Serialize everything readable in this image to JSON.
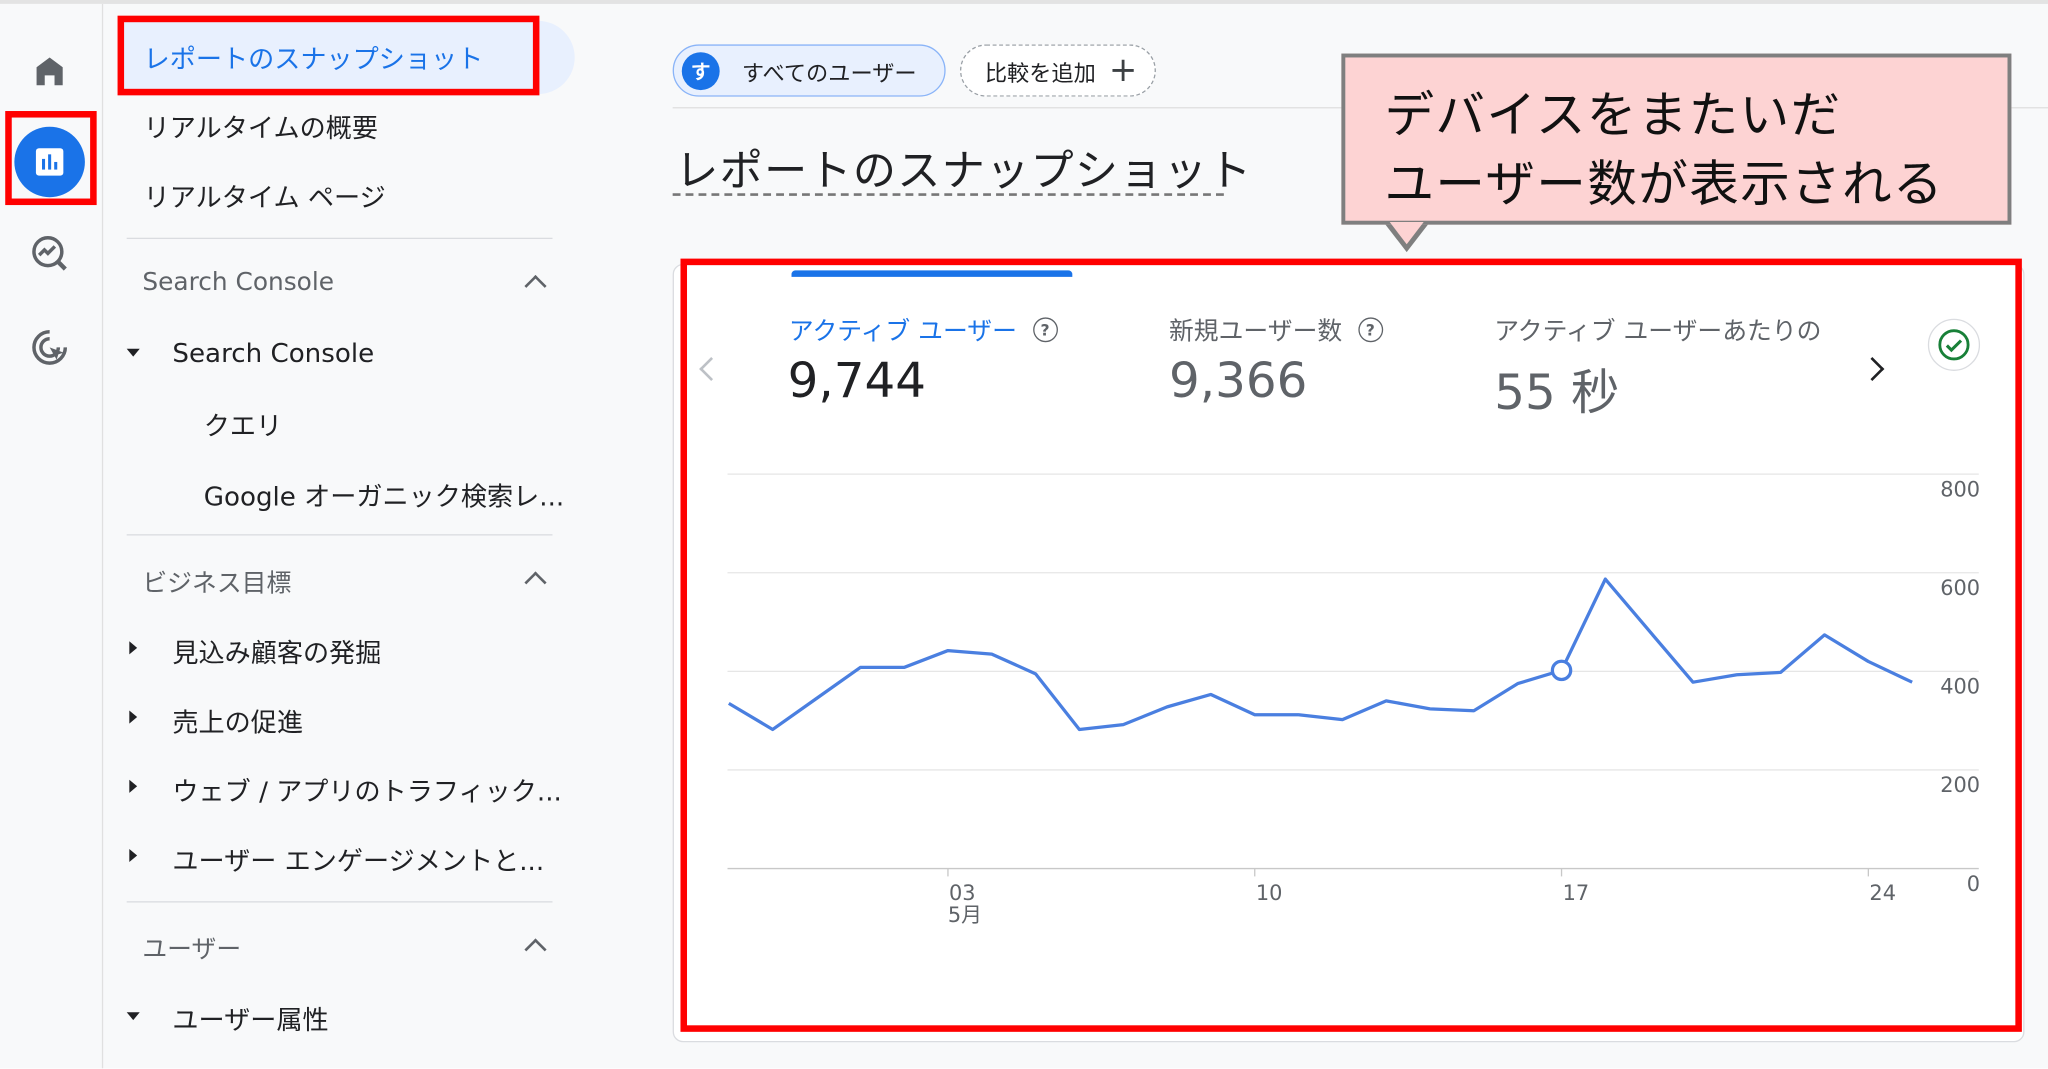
{
  "colors": {
    "accent": "#1a73e8",
    "highlight_box": "#ff0000",
    "callout_bg": "#fdd3d3",
    "callout_border": "#7f7f7f",
    "line": "#4a7fe0"
  },
  "rail": {
    "icons": [
      "home-icon",
      "reports-icon",
      "explore-icon",
      "advertising-icon"
    ]
  },
  "nav": {
    "active_item": "レポートのスナップショット",
    "items": [
      "リアルタイムの概要",
      "リアルタイム ページ"
    ],
    "sections": [
      {
        "title": "Search Console",
        "items": [
          {
            "label": "Search Console",
            "expanded": true
          },
          {
            "label": "クエリ"
          },
          {
            "label": "Google オーガニック検索レ..."
          }
        ]
      },
      {
        "title": "ビジネス目標",
        "items": [
          {
            "label": "見込み顧客の発掘"
          },
          {
            "label": "売上の促進"
          },
          {
            "label": "ウェブ / アプリのトラフィック..."
          },
          {
            "label": "ユーザー エンゲージメントと..."
          }
        ]
      },
      {
        "title": "ユーザー",
        "items": [
          {
            "label": "ユーザー属性",
            "expanded": true
          }
        ]
      }
    ]
  },
  "header": {
    "segment_avatar": "す",
    "segment_label": "すべてのユーザー",
    "compare_label": "比較を追加",
    "page_title": "レポートのスナップショット"
  },
  "callout": {
    "line1": "デバイスをまたいだ",
    "line2": "ユーザー数が表示される"
  },
  "metrics": [
    {
      "label": "アクティブ ユーザー",
      "value": "9,744",
      "active": true
    },
    {
      "label": "新規ユーザー数",
      "value": "9,366"
    },
    {
      "label": "アクティブ ユーザーあたりの",
      "value": "55 秒"
    }
  ],
  "chart_data": {
    "type": "line",
    "x": [
      "4/28",
      "4/29",
      "4/30",
      "5/1",
      "5/2",
      "5/3",
      "5/4",
      "5/5",
      "5/6",
      "5/7",
      "5/8",
      "5/9",
      "5/10",
      "5/11",
      "5/12",
      "5/13",
      "5/14",
      "5/15",
      "5/16",
      "5/17",
      "5/18",
      "5/19",
      "5/20",
      "5/21",
      "5/22",
      "5/23",
      "5/24",
      "5/25",
      "5/26"
    ],
    "series": [
      {
        "values": [
          335,
          282,
          345,
          408,
          408,
          442,
          435,
          395,
          282,
          292,
          328,
          353,
          312,
          312,
          302,
          340,
          324,
          320,
          375,
          402,
          587,
          482,
          378,
          393,
          398,
          474,
          420,
          378
        ]
      }
    ],
    "x_tick_labels": [
      {
        "label": "03",
        "sublabel": "5月",
        "index": 5
      },
      {
        "label": "10",
        "index": 12
      },
      {
        "label": "17",
        "index": 19
      },
      {
        "label": "24",
        "index": 26
      }
    ],
    "y_tick_labels": [
      "0",
      "200",
      "400",
      "600",
      "800"
    ],
    "ylim": [
      0,
      800
    ],
    "grid": true,
    "highlight_index": 19
  }
}
